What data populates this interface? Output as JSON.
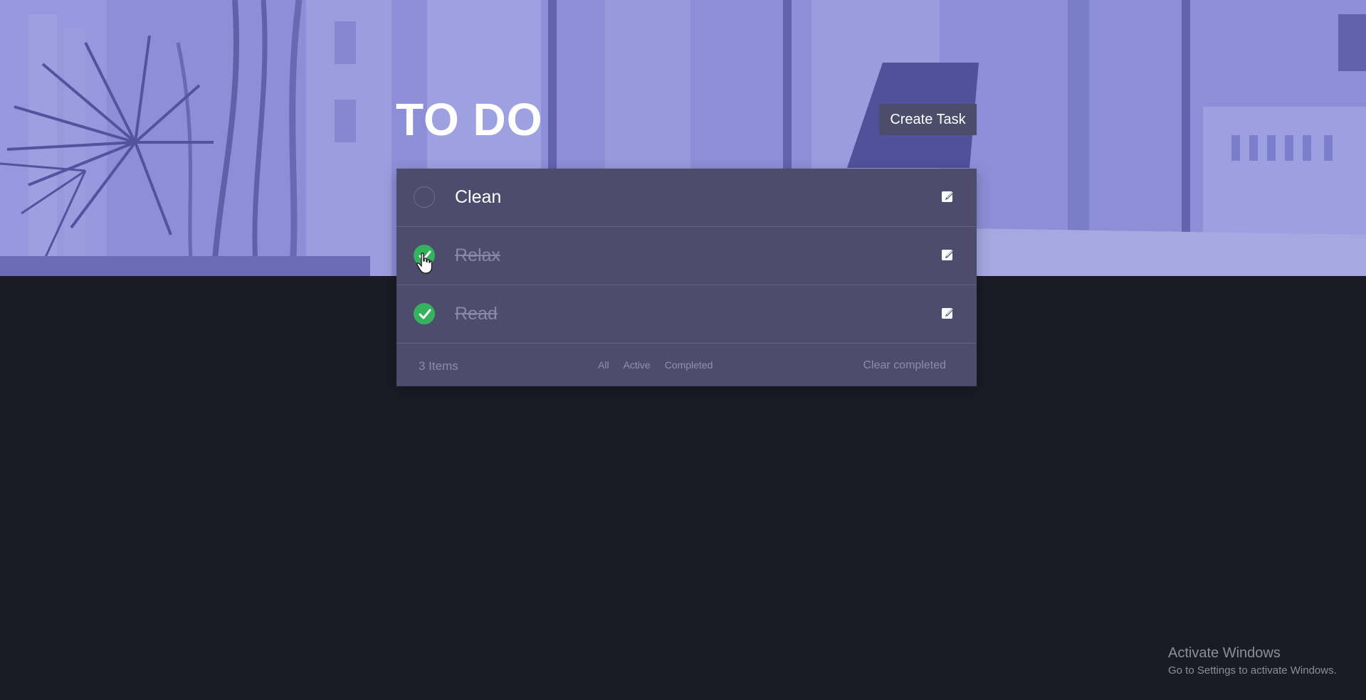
{
  "header": {
    "title": "TO DO",
    "create_button_label": "Create Task"
  },
  "tasks": [
    {
      "label": "Clean",
      "completed": false,
      "check_icon": "circle-outline-icon",
      "edit_icon": "edit-icon"
    },
    {
      "label": "Relax",
      "completed": true,
      "check_icon": "check-icon",
      "edit_icon": "edit-icon"
    },
    {
      "label": "Read",
      "completed": true,
      "check_icon": "check-icon",
      "edit_icon": "edit-icon"
    }
  ],
  "footer": {
    "items_left": "3 Items",
    "filters": [
      "All",
      "Active",
      "Completed"
    ],
    "clear_completed_label": "Clear completed"
  },
  "watermark": {
    "title": "Activate Windows",
    "subtitle": "Go to Settings to activate Windows."
  },
  "colors": {
    "background": "#1b1b26",
    "hero_tint": "#9598da",
    "card": "#4d4c6c",
    "button": "#4c4c6b",
    "check_done": "#34b25d",
    "completed_text": "#8a89a5"
  }
}
